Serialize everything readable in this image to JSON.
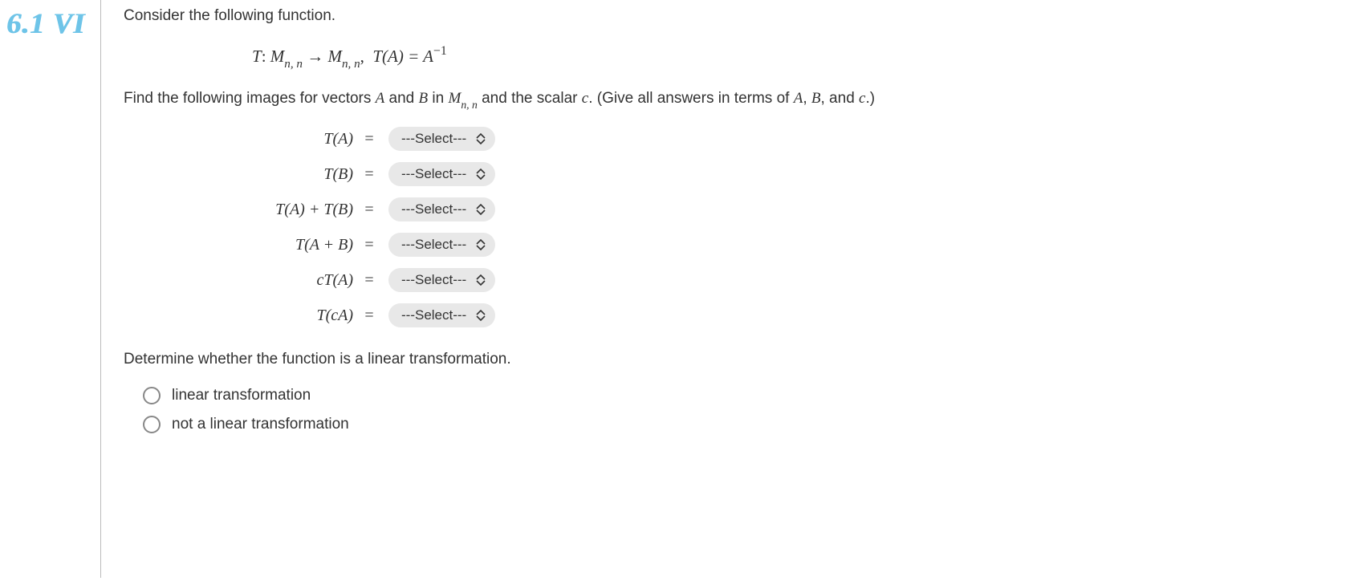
{
  "handwritten": "6.1 VI",
  "intro": "Consider the following function.",
  "function_def": {
    "T_label": "T",
    "colon": ":",
    "M": "M",
    "sub_nn": "n, n",
    "arrow": " → ",
    "sub_nn2": "n, n",
    "comma_after": ",",
    "TA": "T(A) = A",
    "exp": "−1"
  },
  "find_line": {
    "pre": "Find the following images for vectors ",
    "A": "A",
    "and1": " and ",
    "B": "B",
    "in": " in ",
    "M": "M",
    "sub_nn": "n, n",
    "and_scalar": " and the scalar ",
    "c": "c",
    "post": ". (Give all answers in terms of ",
    "A2": "A",
    "comma1": ", ",
    "B2": "B",
    "comma2": ", and ",
    "c2": "c",
    "end": ".)"
  },
  "equations": [
    {
      "label": "T(A)",
      "select": "---Select---"
    },
    {
      "label": "T(B)",
      "select": "---Select---"
    },
    {
      "label": "T(A) + T(B)",
      "select": "---Select---"
    },
    {
      "label": "T(A + B)",
      "select": "---Select---"
    },
    {
      "label": "cT(A)",
      "select": "---Select---"
    },
    {
      "label": "T(cA)",
      "select": "---Select---"
    }
  ],
  "determine": "Determine whether the function is a linear transformation.",
  "radios": [
    "linear transformation",
    "not a linear transformation"
  ]
}
